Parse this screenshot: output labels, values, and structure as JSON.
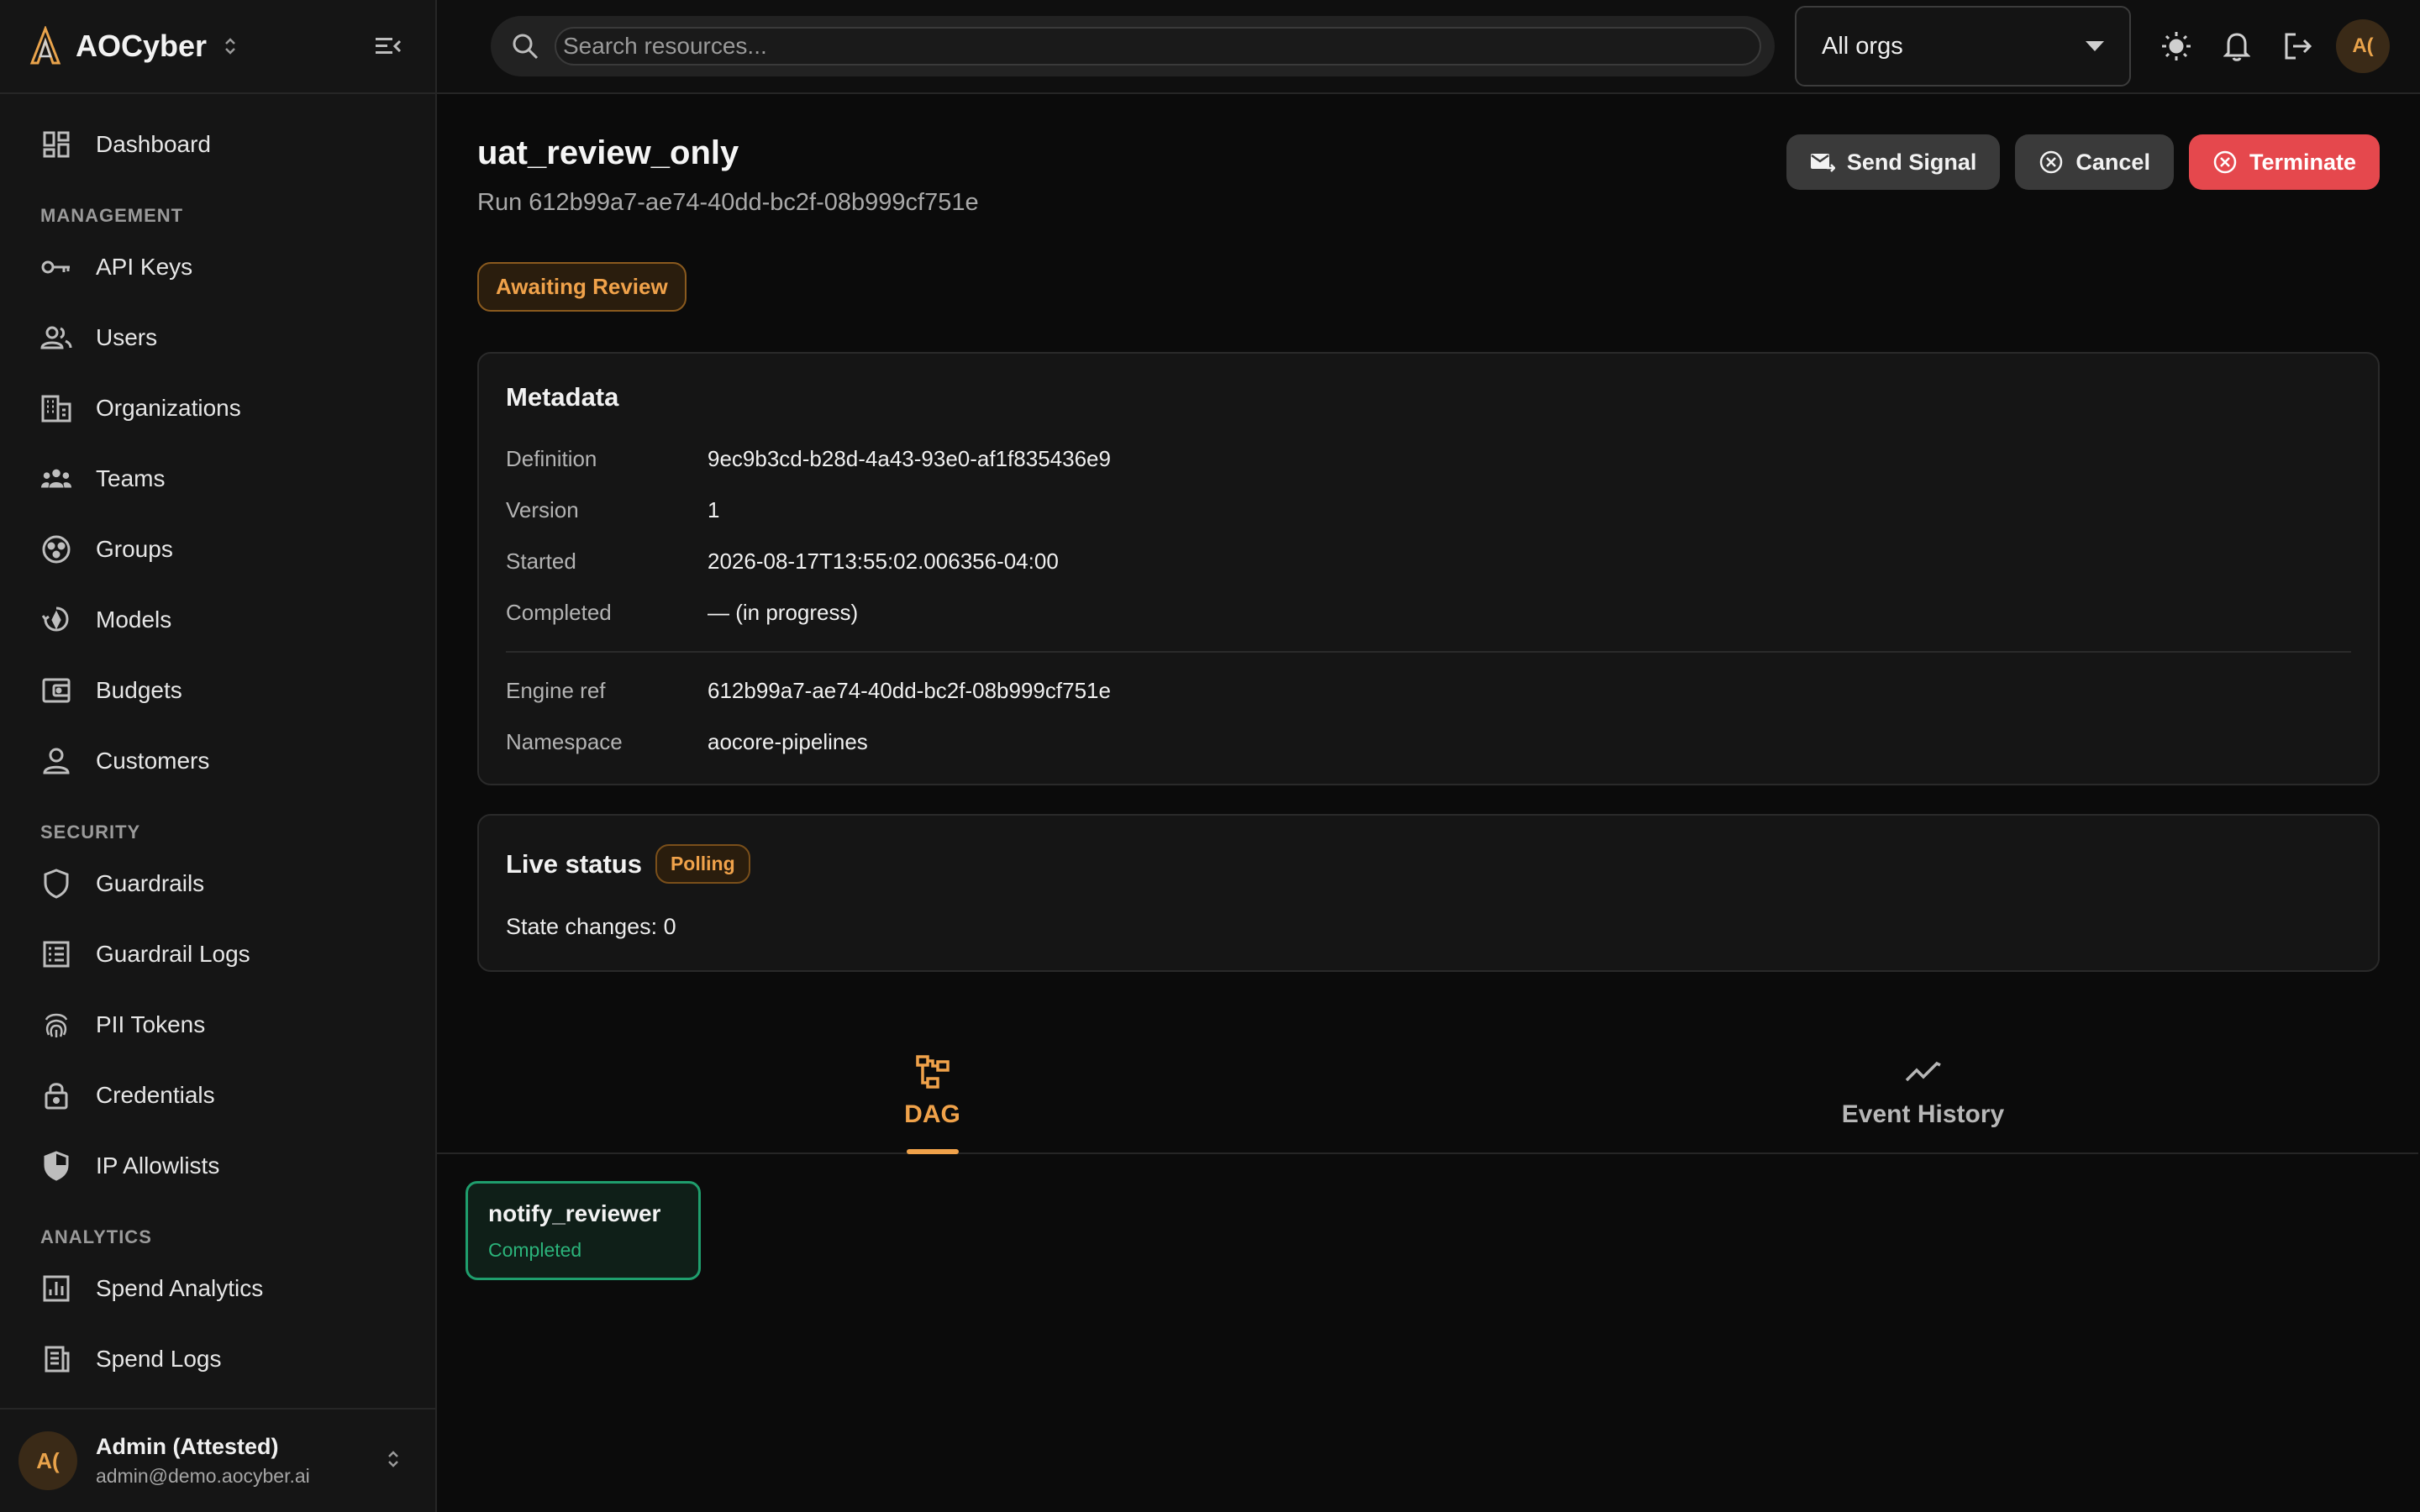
{
  "brand": {
    "name": "AOCyber"
  },
  "sidebar": {
    "items": [
      {
        "label": "Dashboard",
        "icon": "dashboard-icon"
      }
    ],
    "sections": [
      {
        "title": "MANAGEMENT",
        "items": [
          {
            "label": "API Keys",
            "icon": "key-icon"
          },
          {
            "label": "Users",
            "icon": "users-icon"
          },
          {
            "label": "Organizations",
            "icon": "building-icon"
          },
          {
            "label": "Teams",
            "icon": "teams-icon"
          },
          {
            "label": "Groups",
            "icon": "groups-icon"
          },
          {
            "label": "Models",
            "icon": "models-icon"
          },
          {
            "label": "Budgets",
            "icon": "wallet-icon"
          },
          {
            "label": "Customers",
            "icon": "person-icon"
          }
        ]
      },
      {
        "title": "SECURITY",
        "items": [
          {
            "label": "Guardrails",
            "icon": "shield-icon"
          },
          {
            "label": "Guardrail Logs",
            "icon": "list-icon"
          },
          {
            "label": "PII Tokens",
            "icon": "fingerprint-icon"
          },
          {
            "label": "Credentials",
            "icon": "lock-icon"
          },
          {
            "label": "IP Allowlists",
            "icon": "shield-half-icon"
          }
        ]
      },
      {
        "title": "ANALYTICS",
        "items": [
          {
            "label": "Spend Analytics",
            "icon": "bar-chart-icon"
          },
          {
            "label": "Spend Logs",
            "icon": "receipt-icon"
          }
        ]
      }
    ]
  },
  "user": {
    "initials": "A(",
    "name": "Admin (Attested)",
    "email": "admin@demo.aocyber.ai"
  },
  "topbar": {
    "search_placeholder": "Search resources...",
    "org_selected": "All orgs",
    "avatar_initials": "A("
  },
  "run": {
    "title": "uat_review_only",
    "subtitle": "Run 612b99a7-ae74-40dd-bc2f-08b999cf751e",
    "status_badge": "Awaiting Review"
  },
  "actions": {
    "send_signal": "Send Signal",
    "cancel": "Cancel",
    "terminate": "Terminate"
  },
  "metadata": {
    "title": "Metadata",
    "rows": [
      {
        "key": "Definition",
        "value": "9ec9b3cd-b28d-4a43-93e0-af1f835436e9"
      },
      {
        "key": "Version",
        "value": "1"
      },
      {
        "key": "Started",
        "value": "2026-08-17T13:55:02.006356-04:00"
      },
      {
        "key": "Completed",
        "value": "— (in progress)"
      }
    ],
    "rows2": [
      {
        "key": "Engine ref",
        "value": "612b99a7-ae74-40dd-bc2f-08b999cf751e"
      },
      {
        "key": "Namespace",
        "value": "aocore-pipelines"
      }
    ]
  },
  "live_status": {
    "title": "Live status",
    "badge": "Polling",
    "state_changes": "State changes: 0"
  },
  "tabs": [
    {
      "label": "DAG",
      "icon": "dag-icon",
      "active": true
    },
    {
      "label": "Event History",
      "icon": "line-chart-icon",
      "active": false
    }
  ],
  "dag_node": {
    "name": "notify_reviewer",
    "status": "Completed"
  },
  "colors": {
    "accent": "#f0a24a",
    "danger": "#e5484d",
    "success": "#1f9e6d"
  }
}
